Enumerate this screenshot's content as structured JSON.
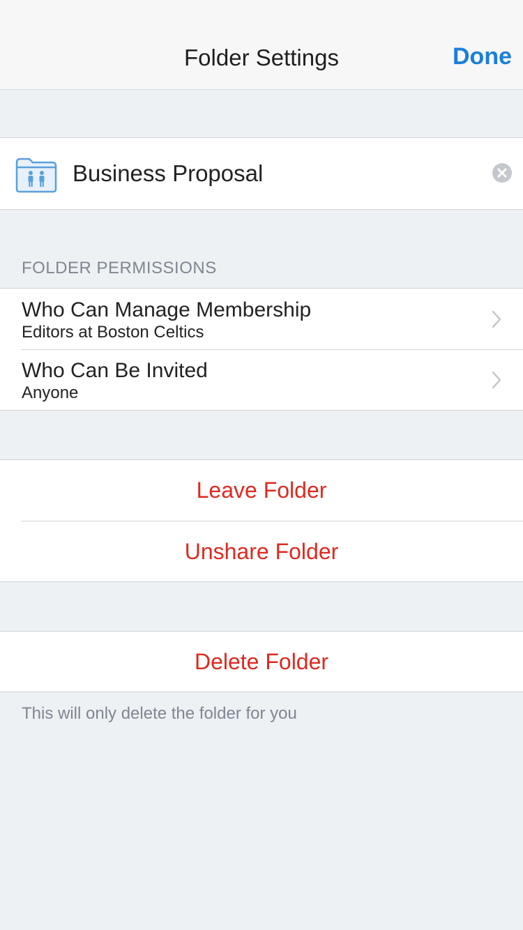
{
  "nav": {
    "title": "Folder Settings",
    "done_label": "Done"
  },
  "folder": {
    "name": "Business Proposal",
    "icon": "shared-folder-icon"
  },
  "permissions": {
    "header": "FOLDER PERMISSIONS",
    "items": [
      {
        "title": "Who Can Manage Membership",
        "value": "Editors at Boston Celtics"
      },
      {
        "title": "Who Can Be Invited",
        "value": "Anyone"
      }
    ]
  },
  "actions": {
    "leave": "Leave Folder",
    "unshare": "Unshare Folder",
    "delete": "Delete Folder"
  },
  "footer": {
    "note": "This will only delete the folder for you"
  },
  "colors": {
    "accent": "#1a7fd9",
    "destructive": "#dd2a1f",
    "background": "#eef1f4"
  }
}
